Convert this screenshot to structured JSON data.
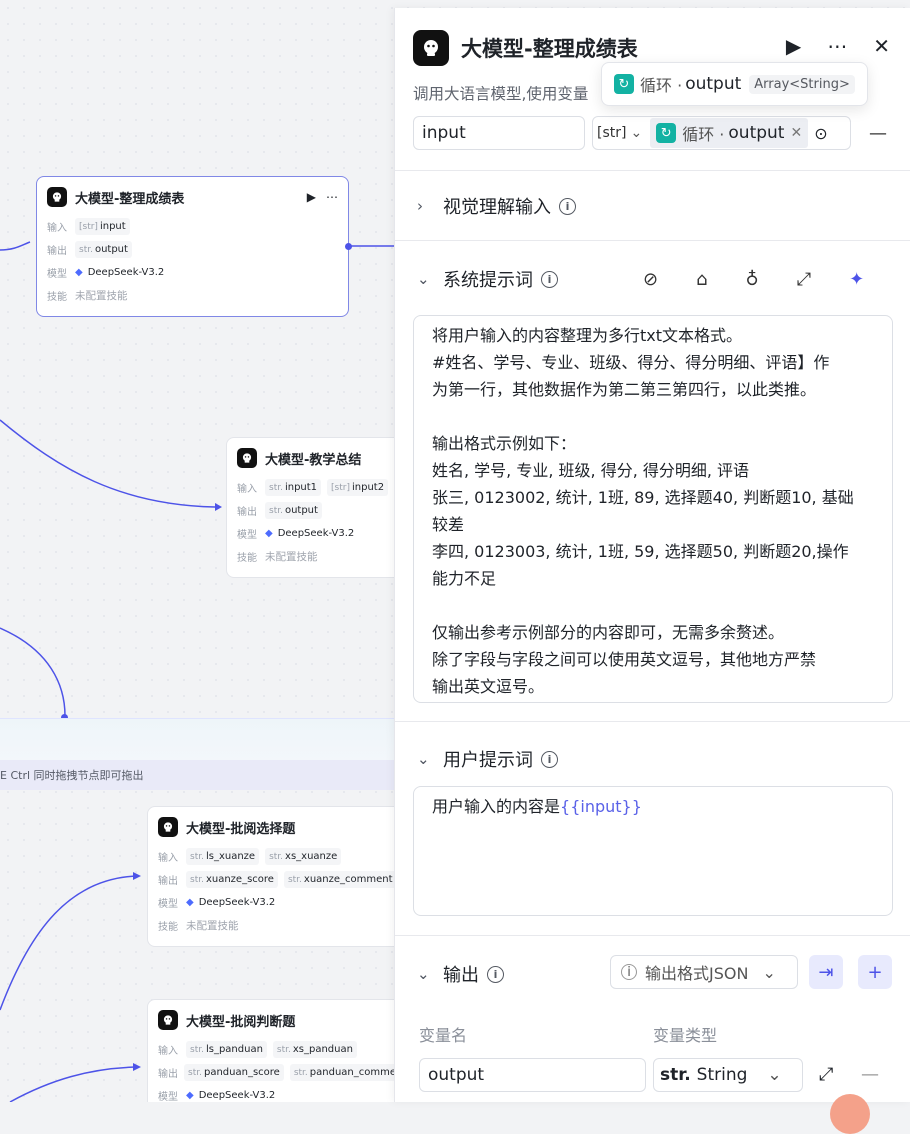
{
  "canvas": {
    "nodes": [
      {
        "title": "大模型-整理成绩表",
        "rows": [
          {
            "label": "输入",
            "chips": [
              {
                "type": "[str]",
                "name": "input"
              }
            ]
          },
          {
            "label": "输出",
            "chips": [
              {
                "type": "str.",
                "name": "output"
              }
            ]
          },
          {
            "label": "模型",
            "model": "DeepSeek-V3.2"
          },
          {
            "label": "技能",
            "muted": "未配置技能"
          }
        ]
      },
      {
        "title": "大模型-教学总结",
        "rows": [
          {
            "label": "输入",
            "chips": [
              {
                "type": "str.",
                "name": "input1"
              },
              {
                "type": "[str]",
                "name": "input2"
              }
            ]
          },
          {
            "label": "输出",
            "chips": [
              {
                "type": "str.",
                "name": "output"
              }
            ]
          },
          {
            "label": "模型",
            "model": "DeepSeek-V3.2"
          },
          {
            "label": "技能",
            "muted": "未配置技能"
          }
        ]
      },
      {
        "title": "大模型-批阅选择题",
        "rows": [
          {
            "label": "输入",
            "chips": [
              {
                "type": "str.",
                "name": "ls_xuanze"
              },
              {
                "type": "str.",
                "name": "xs_xuanze"
              }
            ]
          },
          {
            "label": "输出",
            "chips": [
              {
                "type": "str.",
                "name": "xuanze_score"
              },
              {
                "type": "str.",
                "name": "xuanze_comment"
              }
            ]
          },
          {
            "label": "模型",
            "model": "DeepSeek-V3.2"
          },
          {
            "label": "技能",
            "muted": "未配置技能"
          }
        ]
      },
      {
        "title": "大模型-批阅判断题",
        "rows": [
          {
            "label": "输入",
            "chips": [
              {
                "type": "str.",
                "name": "ls_panduan"
              },
              {
                "type": "str.",
                "name": "xs_panduan"
              }
            ]
          },
          {
            "label": "输出",
            "chips": [
              {
                "type": "str.",
                "name": "panduan_score"
              },
              {
                "type": "str.",
                "name": "panduan_comme"
              }
            ]
          },
          {
            "label": "模型",
            "model": "DeepSeek-V3.2"
          }
        ]
      }
    ],
    "loop_hint": "E Ctrl 同时拖拽节点即可拖出"
  },
  "panel": {
    "title": "大模型-整理成绩表",
    "description": "调用大语言模型,使用变量",
    "tooltip": {
      "prefix": "循环 ·",
      "name": "output",
      "type": "Array<String>"
    },
    "input_row": {
      "name": "input",
      "type": "[str]",
      "ref_prefix": "循环 ·",
      "ref_name": "output"
    },
    "vision": {
      "label": "视觉理解输入"
    },
    "system_prompt": {
      "label": "系统提示词",
      "lines": [
        "将用户输入的内容整理为多行txt文本格式。",
        "#姓名、学号、专业、班级、得分、得分明细、评语】作",
        "为第一行，其他数据作为第二第三第四行，以此类推。",
        "",
        "输出格式示例如下：",
        "姓名, 学号, 专业, 班级, 得分, 得分明细, 评语",
        "张三, 0123002, 统计, 1班, 89, 选择题40, 判断题10, 基础",
        "较差",
        "李四, 0123003, 统计, 1班, 59, 选择题50, 判断题20,操作",
        "能力不足",
        "",
        "仅输出参考示例部分的内容即可，无需多余赘述。",
        "除了字段与字段之间可以使用英文逗号，其他地方严禁",
        "输出英文逗号。"
      ]
    },
    "user_prompt": {
      "label": "用户提示词",
      "prefix": "用户输入的内容是",
      "variable": "{{input}}"
    },
    "output": {
      "label": "输出",
      "format_label": "输出格式JSON",
      "col_name": "变量名",
      "col_type": "变量类型",
      "var_name": "output",
      "var_type_prefix": "str.",
      "var_type": "String"
    }
  }
}
